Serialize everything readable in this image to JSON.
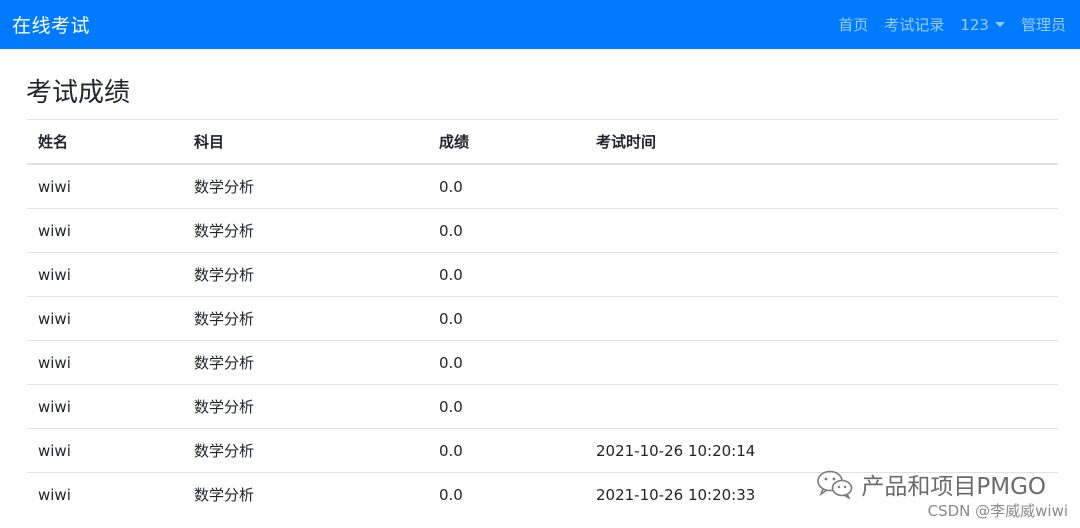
{
  "navbar": {
    "brand": "在线考试",
    "links": [
      {
        "label": "首页"
      },
      {
        "label": "考试记录"
      },
      {
        "label": "123"
      },
      {
        "label": "管理员"
      }
    ]
  },
  "page": {
    "title": "考试成绩"
  },
  "table": {
    "headers": [
      "姓名",
      "科目",
      "成绩",
      "考试时间"
    ],
    "rows": [
      [
        "wiwi",
        "数学分析",
        "0.0",
        ""
      ],
      [
        "wiwi",
        "数学分析",
        "0.0",
        ""
      ],
      [
        "wiwi",
        "数学分析",
        "0.0",
        ""
      ],
      [
        "wiwi",
        "数学分析",
        "0.0",
        ""
      ],
      [
        "wiwi",
        "数学分析",
        "0.0",
        ""
      ],
      [
        "wiwi",
        "数学分析",
        "0.0",
        ""
      ],
      [
        "wiwi",
        "数学分析",
        "0.0",
        "2021-10-26 10:20:14"
      ],
      [
        "wiwi",
        "数学分析",
        "0.0",
        "2021-10-26 10:20:33"
      ]
    ]
  },
  "watermark": {
    "text": "产品和项目PMGO",
    "icon": "wechat-icon",
    "credit": "CSDN @李威威wiwi"
  },
  "colors": {
    "navbar_bg": "#007bff",
    "nav_link": "#9fcbff",
    "border": "#dee2e6"
  }
}
